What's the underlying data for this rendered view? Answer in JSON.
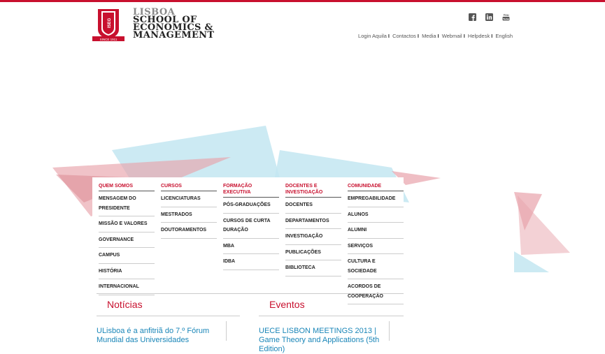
{
  "logo": {
    "line1": "LISBOA",
    "line2": "SCHOOL OF",
    "line3": "ECONOMICS &",
    "line4": "MANAGEMENT",
    "badge": "ISEG",
    "since": "SINCE 1911"
  },
  "social": [
    "facebook-icon",
    "linkedin-icon",
    "youtube-icon"
  ],
  "toplinks": [
    "Login Aquila",
    "Contactos",
    "Media",
    "Webmail",
    "Helpdesk",
    "English"
  ],
  "menu": [
    {
      "title": "QUEM SOMOS",
      "items": [
        "MENSAGEM DO PRESIDENTE",
        "MISSÃO E VALORES",
        "GOVERNANCE",
        "CAMPUS",
        "HISTÓRIA",
        "INTERNACIONAL"
      ]
    },
    {
      "title": "CURSOS",
      "items": [
        "LICENCIATURAS",
        "MESTRADOS",
        "DOUTORAMENTOS"
      ]
    },
    {
      "title": "FORMAÇÃO EXECUTIVA",
      "items": [
        "PÓS-GRADUAÇÕES",
        "CURSOS DE CURTA DURAÇÃO",
        "MBA",
        "IDBA"
      ]
    },
    {
      "title": "DOCENTES E INVESTIGAÇÃO",
      "items": [
        "DOCENTES",
        "DEPARTAMENTOS",
        "INVESTIGAÇÃO",
        "PUBLICAÇÕES",
        "BIBLIOTECA"
      ]
    },
    {
      "title": "COMUNIDADE",
      "items": [
        "EMPREGABILIDADE",
        "ALUNOS",
        "ALUMNI",
        "SERVIÇOS",
        "CULTURA E SOCIEDADE",
        "ACORDOS DE COOPERAÇÃO"
      ]
    }
  ],
  "sections": {
    "news_title": "Notícias",
    "events_title": "Eventos",
    "news_item": "ULisboa é a anfitriã do 7.º Fórum Mundial das Universidades",
    "event_item": "UECE LISBON MEETINGS 2013 | Game Theory and Applications (5th Edition)"
  },
  "colors": {
    "brand": "#c8102e",
    "link": "#1a86b8"
  }
}
